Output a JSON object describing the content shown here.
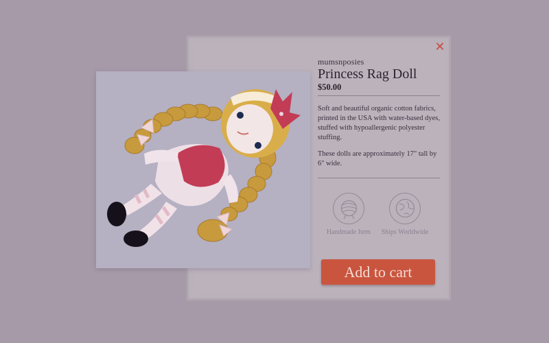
{
  "product": {
    "seller": "mumsnposies",
    "title": "Princess Rag Doll",
    "price": "$50.00",
    "description": [
      "Soft and beautiful organic cotton fabrics, printed in the USA with water-based dyes, stuffed with hypoallergenic polyester stuffing.",
      "These dolls are approximately 17\" tall by 6\" wide."
    ]
  },
  "features": [
    {
      "label": "Handmade Item",
      "icon": "yarn-icon"
    },
    {
      "label": "Ships Worldwide",
      "icon": "globe-icon"
    }
  ],
  "actions": {
    "close_glyph": "✕",
    "add_to_cart": "Add to cart"
  },
  "colors": {
    "overlay": "#a69aa8",
    "accent": "#c9553f"
  }
}
